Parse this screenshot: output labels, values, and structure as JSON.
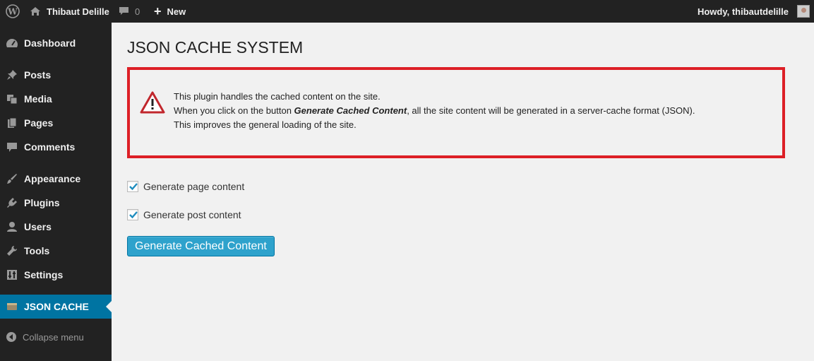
{
  "admin_bar": {
    "site_name": "Thibaut Delille",
    "comment_count": "0",
    "new_label": "New",
    "howdy": "Howdy, thibautdelille"
  },
  "sidebar": {
    "items": [
      {
        "label": "Dashboard",
        "icon": "dashboard-icon"
      },
      {
        "label": "Posts",
        "icon": "pin-icon"
      },
      {
        "label": "Media",
        "icon": "media-icon"
      },
      {
        "label": "Pages",
        "icon": "pages-icon"
      },
      {
        "label": "Comments",
        "icon": "comment-icon"
      },
      {
        "label": "Appearance",
        "icon": "brush-icon"
      },
      {
        "label": "Plugins",
        "icon": "plugin-icon"
      },
      {
        "label": "Users",
        "icon": "user-icon"
      },
      {
        "label": "Tools",
        "icon": "wrench-icon"
      },
      {
        "label": "Settings",
        "icon": "settings-icon"
      },
      {
        "label": "JSON CACHE",
        "icon": "cache-icon",
        "active": true
      }
    ],
    "collapse_label": "Collapse menu"
  },
  "main": {
    "title": "JSON CACHE SYSTEM",
    "notice": {
      "line1": "This plugin handles the cached content on the site.",
      "line2_prefix": "When you click on the button ",
      "line2_emph": "Generate Cached Content",
      "line2_suffix": ", all the site content will be generated in a server-cache format (JSON).",
      "line3": "This improves the general loading of the site."
    },
    "options": [
      {
        "label": "Generate page content",
        "checked": true
      },
      {
        "label": "Generate post content",
        "checked": true
      }
    ],
    "button_label": "Generate Cached Content"
  },
  "colors": {
    "admin_bg": "#222222",
    "active_menu": "#0074a2",
    "button": "#2ea2cc",
    "notice_border": "#dd1f26"
  }
}
